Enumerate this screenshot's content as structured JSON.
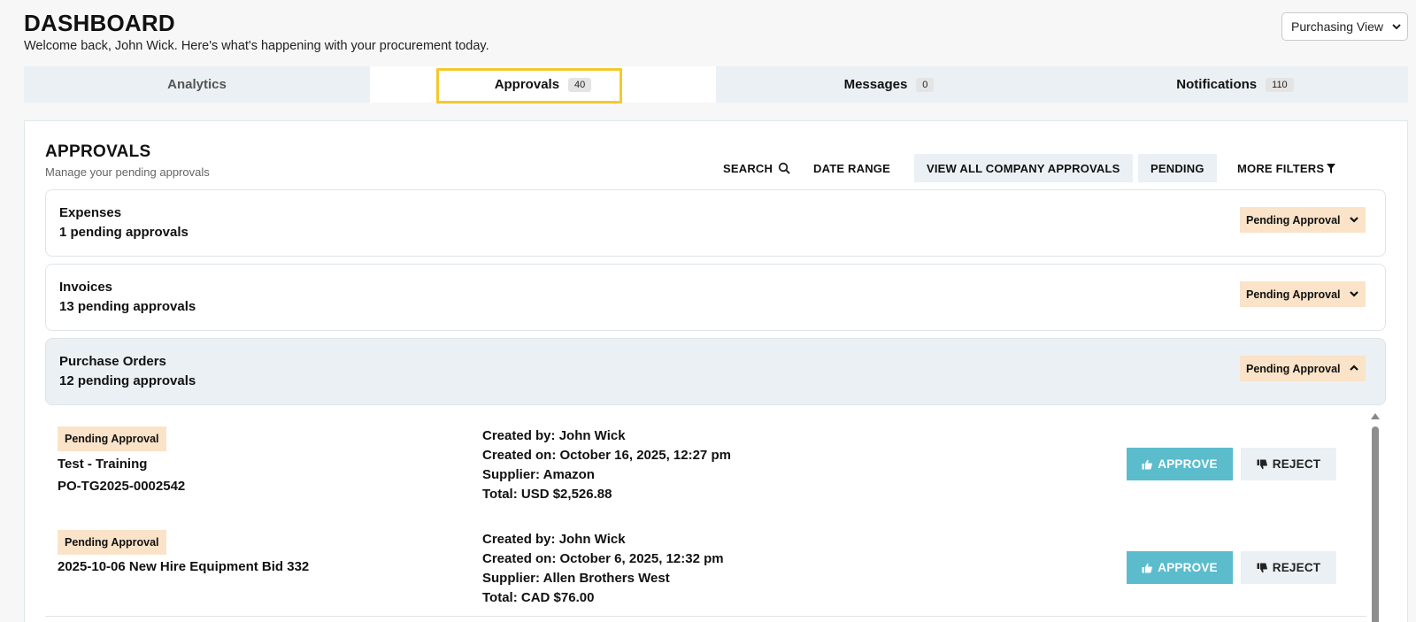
{
  "header": {
    "title": "DASHBOARD",
    "welcome": "Welcome back, John Wick. Here's what's happening with your procurement today.",
    "view_select": "Purchasing View"
  },
  "tabs": [
    {
      "label": "Analytics",
      "badge": ""
    },
    {
      "label": "Approvals",
      "badge": "40"
    },
    {
      "label": "Messages",
      "badge": "0"
    },
    {
      "label": "Notifications",
      "badge": "110"
    }
  ],
  "approvals": {
    "title": "APPROVALS",
    "subtitle": "Manage your pending approvals",
    "toolbar": {
      "search": "SEARCH",
      "date_range": "DATE RANGE",
      "view_all": "VIEW ALL COMPANY APPROVALS",
      "pending": "PENDING",
      "more_filters": "MORE FILTERS"
    },
    "groups": [
      {
        "title": "Expenses",
        "count": "1 pending approvals",
        "status": "Pending Approval",
        "expanded": false
      },
      {
        "title": "Invoices",
        "count": "13 pending approvals",
        "status": "Pending Approval",
        "expanded": false
      },
      {
        "title": "Purchase Orders",
        "count": "12 pending approvals",
        "status": "Pending Approval",
        "expanded": true
      }
    ],
    "rows": [
      {
        "status": "Pending Approval",
        "name": "Test - Training",
        "number": "PO-TG2025-0002542",
        "created_by": "Created by: John Wick",
        "created_on": "Created on: October 16, 2025, 12:27 pm",
        "supplier": "Supplier: Amazon",
        "total": "Total: USD $2,526.88",
        "approve": "APPROVE",
        "reject": "REJECT"
      },
      {
        "status": "Pending Approval",
        "name": "2025-10-06 New Hire Equipment Bid 332",
        "number": "",
        "created_by": "Created by: John Wick",
        "created_on": "Created on: October 6, 2025, 12:32 pm",
        "supplier": "Supplier: Allen Brothers West",
        "total": "Total: CAD $76.00",
        "approve": "APPROVE",
        "reject": "REJECT"
      }
    ]
  },
  "colors": {
    "accent_approve": "#5bbccc",
    "status_bg": "#fae3c8",
    "tab_bg": "#eaf0f4",
    "focus_ring": "#f4c92e"
  },
  "icons": [
    "search-icon",
    "filter-icon",
    "chevron-down-icon",
    "chevron-up-icon",
    "thumbs-up-icon",
    "thumbs-down-icon"
  ]
}
